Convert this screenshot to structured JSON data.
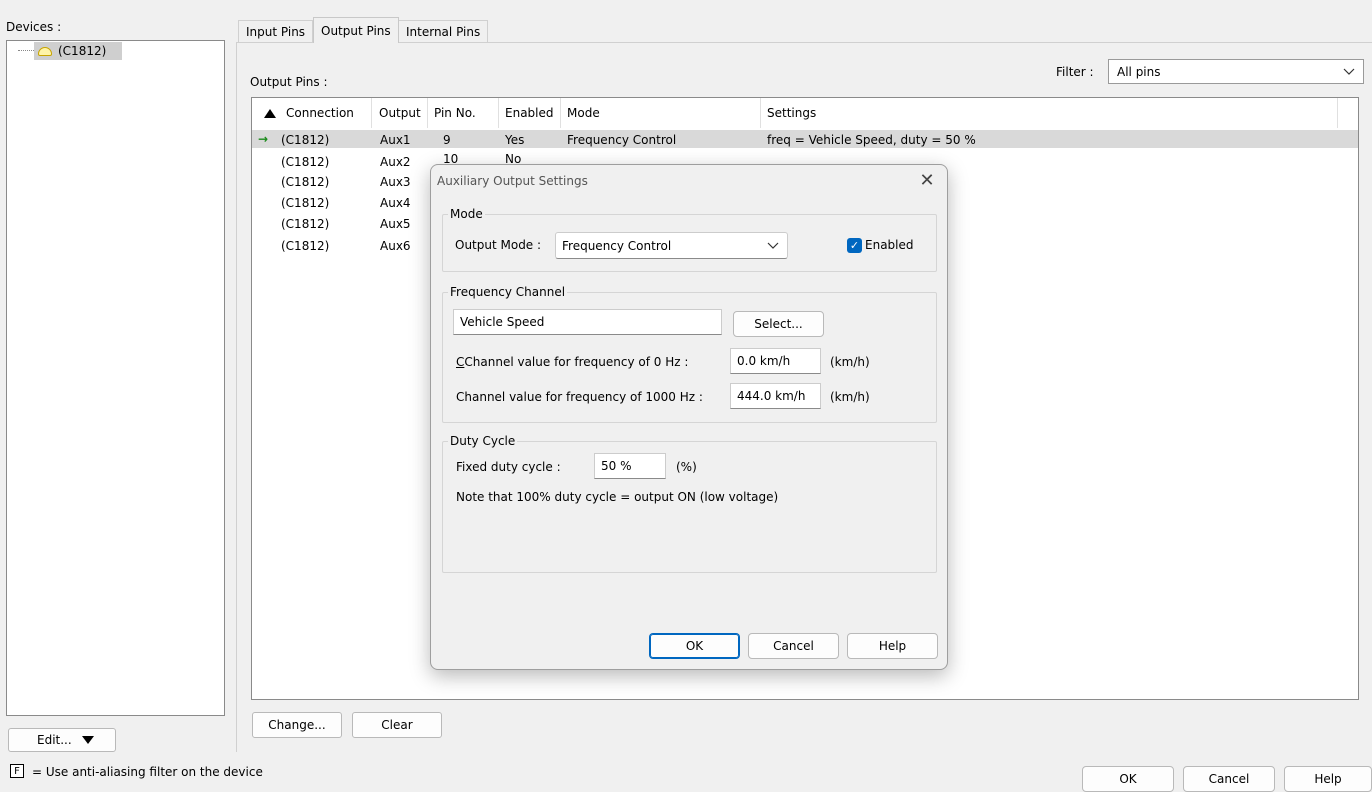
{
  "devices": {
    "label": "Devices :",
    "tree_node": "(C1812)",
    "edit_button": "Edit...",
    "legend_glyph": "F",
    "legend_text": "= Use anti-aliasing filter on the device"
  },
  "tabs": [
    {
      "label": "Input Pins",
      "active": false
    },
    {
      "label": "Output Pins",
      "active": true
    },
    {
      "label": "Internal Pins",
      "active": false
    }
  ],
  "output_pins": {
    "label": "Output Pins :",
    "filter_label": "Filter :",
    "filter_value": "All pins",
    "columns": [
      "Connection",
      "Output",
      "Pin No.",
      "Enabled",
      "Mode",
      "Settings"
    ],
    "rows": [
      {
        "connection": "(C1812)",
        "output": "Aux1",
        "pin": "9",
        "enabled": "Yes",
        "mode": "Frequency Control",
        "settings": "freq = Vehicle Speed, duty = 50 %"
      },
      {
        "connection": "(C1812)",
        "output": "Aux2",
        "pin": "10",
        "enabled": "No",
        "mode": "",
        "settings": ""
      },
      {
        "connection": "(C1812)",
        "output": "Aux3",
        "pin": "",
        "enabled": "",
        "mode": "",
        "settings": ""
      },
      {
        "connection": "(C1812)",
        "output": "Aux4",
        "pin": "",
        "enabled": "",
        "mode": "",
        "settings": ""
      },
      {
        "connection": "(C1812)",
        "output": "Aux5",
        "pin": "",
        "enabled": "",
        "mode": "",
        "settings": ""
      },
      {
        "connection": "(C1812)",
        "output": "Aux6",
        "pin": "",
        "enabled": "",
        "mode": "",
        "settings": ""
      }
    ],
    "change_button": "Change...",
    "clear_button": "Clear"
  },
  "footer": {
    "ok": "OK",
    "cancel": "Cancel",
    "help": "Help"
  },
  "dialog": {
    "title": "Auxiliary Output Settings",
    "close_glyph": "✕",
    "mode_group": "Mode",
    "output_mode_label": "Output Mode :",
    "output_mode_value": "Frequency Control",
    "enabled_label": "Enabled",
    "enabled_checked": true,
    "freq_group": "Frequency Channel",
    "channel_value": "Vehicle Speed",
    "select_button": "Select...",
    "zero_hz_label": "Channel value for frequency of 0 Hz :",
    "zero_hz_value": "0.0 km/h",
    "zero_hz_unit": "(km/h)",
    "max_hz_label": "Channel value for frequency of 1000 Hz :",
    "max_hz_value": "444.0 km/h",
    "max_hz_unit": "(km/h)",
    "duty_group": "Duty Cycle",
    "duty_label": "Fixed duty cycle :",
    "duty_value": "50 %",
    "duty_unit": "(%)",
    "duty_note": "Note that 100% duty cycle = output ON (low voltage)",
    "ok": "OK",
    "cancel": "Cancel",
    "help": "Help"
  }
}
